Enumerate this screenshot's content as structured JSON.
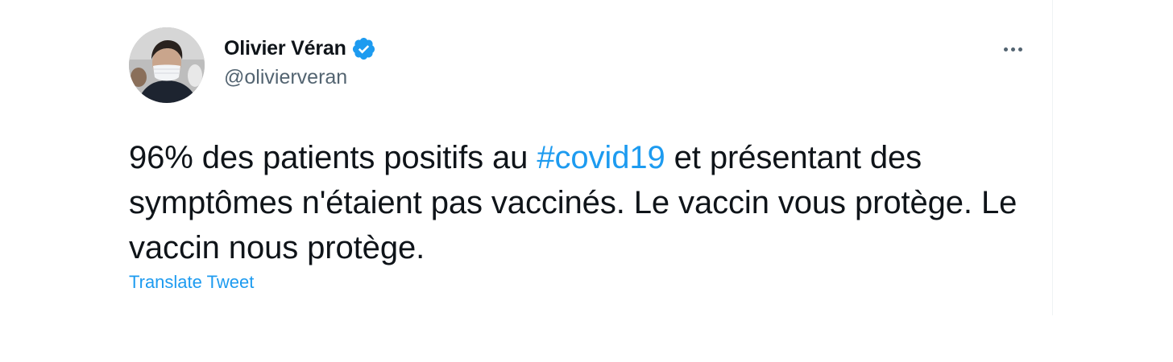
{
  "tweet": {
    "author": {
      "display_name": "Olivier Véran",
      "handle": "@olivierveran",
      "verified": true
    },
    "text": {
      "part1": "96% des patients positifs au ",
      "hashtag": "#covid19",
      "part2": " et présentant des symptômes n'étaient pas vaccinés. Le vaccin vous protège. Le vaccin nous protège."
    },
    "translate_label": "Translate Tweet",
    "more_icon": "more-horizontal-icon"
  },
  "colors": {
    "accent": "#1d9bf0",
    "text": "#0f1419",
    "secondary_text": "#536471"
  }
}
